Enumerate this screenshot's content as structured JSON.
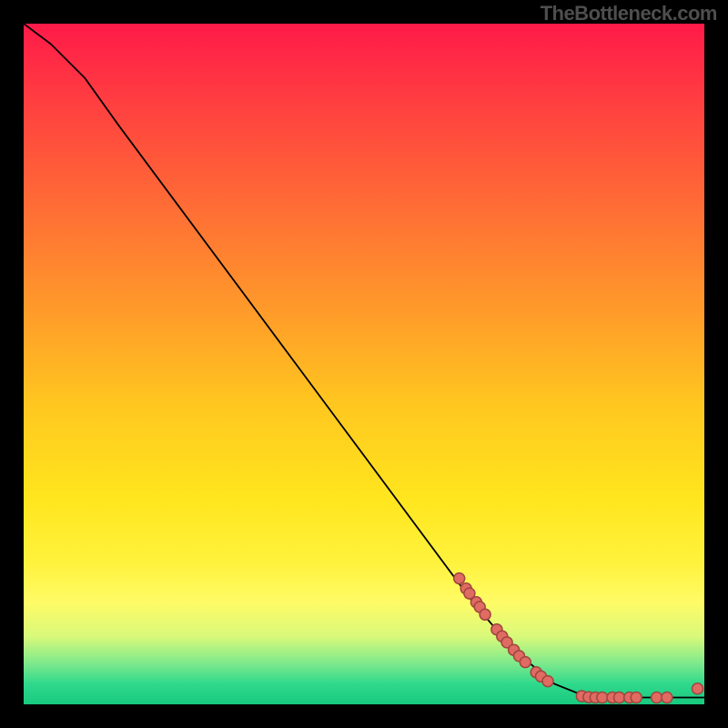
{
  "attribution": "TheBottleneck.com",
  "colors": {
    "page_bg": "#000000",
    "curve_stroke": "#000000",
    "dot_fill": "#e06b62",
    "dot_stroke": "#a0463f"
  },
  "chart_data": {
    "type": "line",
    "title": "",
    "xlabel": "",
    "ylabel": "",
    "xlim": [
      0,
      100
    ],
    "ylim": [
      0,
      100
    ],
    "grid": false,
    "axes_visible": false,
    "legend": null,
    "annotations": [],
    "curve": [
      {
        "x": 0,
        "y": 100
      },
      {
        "x": 4,
        "y": 97
      },
      {
        "x": 9,
        "y": 92
      },
      {
        "x": 14,
        "y": 85
      },
      {
        "x": 40,
        "y": 50
      },
      {
        "x": 66,
        "y": 15
      },
      {
        "x": 72,
        "y": 8
      },
      {
        "x": 78,
        "y": 3
      },
      {
        "x": 83,
        "y": 1
      },
      {
        "x": 100,
        "y": 1
      }
    ],
    "dots": [
      {
        "x": 64,
        "y": 18.5
      },
      {
        "x": 65,
        "y": 17
      },
      {
        "x": 65.5,
        "y": 16.3
      },
      {
        "x": 66.5,
        "y": 15
      },
      {
        "x": 67,
        "y": 14.3
      },
      {
        "x": 67.8,
        "y": 13.2
      },
      {
        "x": 69.5,
        "y": 11
      },
      {
        "x": 70.3,
        "y": 10
      },
      {
        "x": 71,
        "y": 9.1
      },
      {
        "x": 72,
        "y": 8
      },
      {
        "x": 72.8,
        "y": 7.1
      },
      {
        "x": 73.7,
        "y": 6.2
      },
      {
        "x": 75.3,
        "y": 4.7
      },
      {
        "x": 76,
        "y": 4.1
      },
      {
        "x": 77,
        "y": 3.4
      },
      {
        "x": 82,
        "y": 1.2
      },
      {
        "x": 83,
        "y": 1.05
      },
      {
        "x": 84,
        "y": 1
      },
      {
        "x": 85,
        "y": 1
      },
      {
        "x": 86.5,
        "y": 1
      },
      {
        "x": 87.5,
        "y": 1
      },
      {
        "x": 89,
        "y": 1
      },
      {
        "x": 90,
        "y": 1
      },
      {
        "x": 93,
        "y": 1
      },
      {
        "x": 94.5,
        "y": 1
      },
      {
        "x": 99,
        "y": 2.3
      }
    ]
  }
}
